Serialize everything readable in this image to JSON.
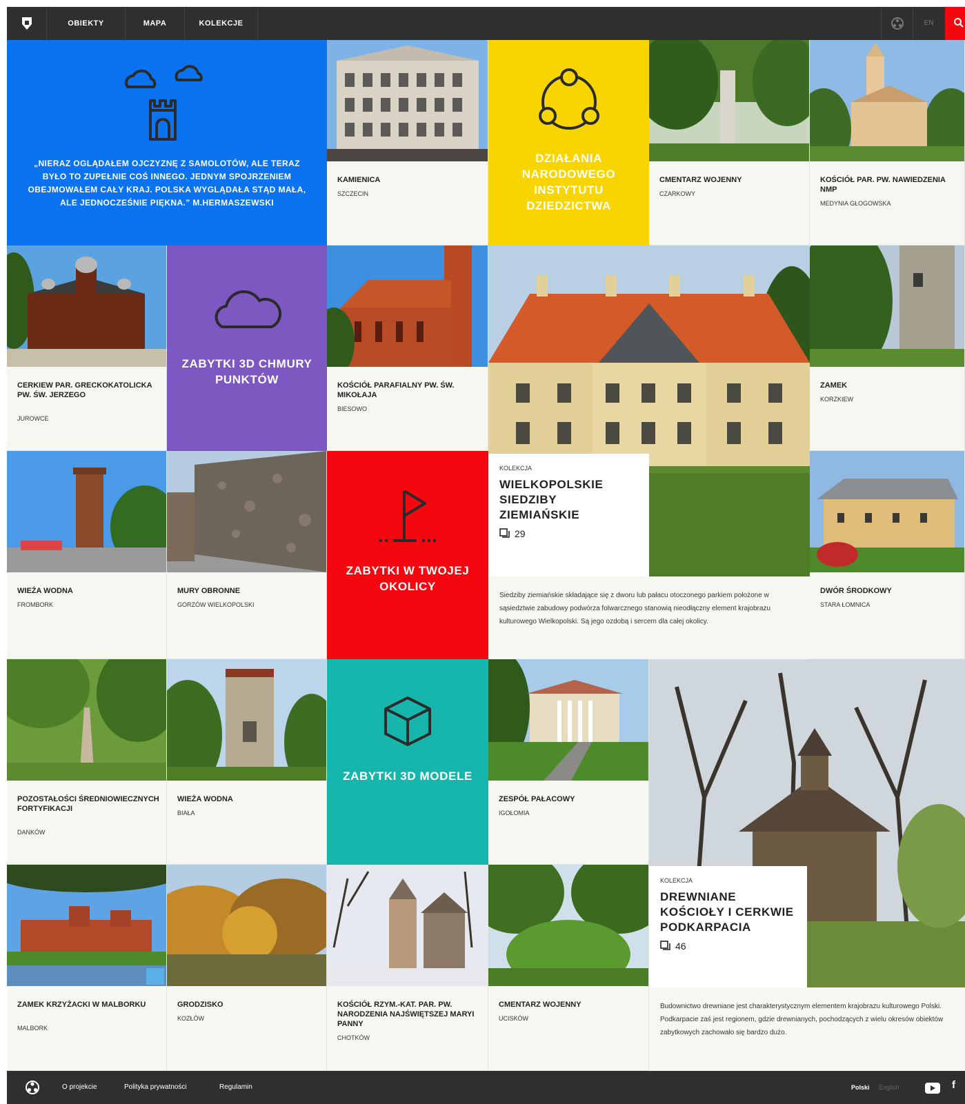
{
  "nav": {
    "items": [
      "OBIEKTY",
      "MAPA",
      "KOLEKCJE"
    ],
    "lang": "EN"
  },
  "colors": {
    "blue": "#0b73f0",
    "yellow": "#f8d500",
    "purple": "#7d58c0",
    "red": "#f4070f",
    "teal": "#16b6ac",
    "dark": "#2f2f2f"
  },
  "quote": {
    "text": "„NIERAZ OGLĄDAŁEM OJCZYZNĘ Z SAMOLOTÓW, ALE TERAZ BYŁO TO ZUPEŁNIE COŚ INNEGO. JEDNYM SPOJRZENIEM OBEJMOWAŁEM CAŁY KRAJ. POLSKA WYGLĄDAŁA STĄD MAŁA, ALE JEDNOCZEŚNIE PIĘKNA.” M.HERMASZEWSKI"
  },
  "features": {
    "institute": "DZIAŁANIA NARODOWEGO INSTYTUTU DZIEDZICTWA",
    "cloud3d": "ZABYTKI 3D CHMURY PUNKTÓW",
    "nearby": "ZABYTKI W TWOJEJ OKOLICY",
    "models3d": "ZABYTKI 3D MODELE"
  },
  "cards": [
    {
      "title": "KAMIENICA",
      "loc": "SZCZECIN"
    },
    {
      "title": "CMENTARZ WOJENNY",
      "loc": "CZARKOWY"
    },
    {
      "title": "KOŚCIÓŁ PAR. PW. NAWIEDZENIA NMP",
      "loc": "MEDYNIA GŁOGOWSKA"
    },
    {
      "title": "CERKIEW PAR. GRECKOKATOLICKA PW. ŚW. JERZEGO",
      "loc": "JUROWCE"
    },
    {
      "title": "KOŚCIÓŁ PARAFIALNY PW. ŚW. MIKOŁAJA",
      "loc": "BIESOWO"
    },
    {
      "title": "ZAMEK",
      "loc": "KORZKIEW"
    },
    {
      "title": "WIEŻA WODNA",
      "loc": "FROMBORK"
    },
    {
      "title": "MURY OBRONNE",
      "loc": "GORZÓW WIELKOPOLSKI"
    },
    {
      "title": "DWÓR ŚRODKOWY",
      "loc": "STARA ŁOMNICA"
    },
    {
      "title": "POZOSTAŁOŚCI ŚREDNIOWIECZNYCH FORTYFIKACJI",
      "loc": "DANKÓW"
    },
    {
      "title": "WIEŻA WODNA",
      "loc": "BIAŁA"
    },
    {
      "title": "ZESPÓŁ PAŁACOWY",
      "loc": "IGOŁOMIA"
    },
    {
      "title": "ZAMEK KRZYŻACKI W MALBORKU",
      "loc": "MALBORK"
    },
    {
      "title": "GRODZISKO",
      "loc": "KOZŁÓW"
    },
    {
      "title": "KOŚCIÓŁ RZYM.-KAT. PAR. PW. NARODZENIA NAJŚWIĘTSZEJ MARYI PANNY",
      "loc": "CHOTKÓW"
    },
    {
      "title": "CMENTARZ WOJENNY",
      "loc": "UCISKÓW"
    }
  ],
  "collections": [
    {
      "kicker": "KOLEKCJA",
      "title": "WIELKOPOLSKIE SIEDZIBY ZIEMIAŃSKIE",
      "count": "29",
      "desc": "Siedziby ziemiańskie składające się z dworu lub pałacu otoczonego parkiem położone w sąsiedztwie zabudowy podwórza folwarcznego stanowią nieodłączny element krajobrazu kulturowego Wielkopolski. Są jego ozdobą i sercem dla całej okolicy."
    },
    {
      "kicker": "KOLEKCJA",
      "title": "DREWNIANE KOŚCIOŁY I CERKWIE PODKARPACIA",
      "count": "46",
      "desc": "Budownictwo drewniane jest charakterystycznym elementem krajobrazu kulturowego Polski. Podkarpacie zaś jest regionem, gdzie drewnianych, pochodzących z wielu okresów obiektów zabytkowych zachowało się bardzo dużo."
    }
  ],
  "footer": {
    "links": [
      "O projekcie",
      "Polityka prywatności",
      "Regulamin"
    ],
    "lang_active": "Polski",
    "lang_other": "English",
    "fb": "f"
  }
}
